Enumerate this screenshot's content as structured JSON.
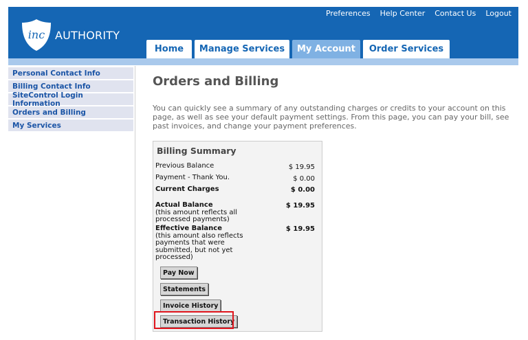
{
  "header": {
    "logo_mark": "inc",
    "logo_text": "AUTHORITY",
    "links": [
      "Preferences",
      "Help Center",
      "Contact Us",
      "Logout"
    ]
  },
  "tabs": [
    {
      "label": "Home",
      "active": false
    },
    {
      "label": "Manage Services",
      "active": false
    },
    {
      "label": "My Account",
      "active": true
    },
    {
      "label": "Order Services",
      "active": false
    }
  ],
  "sidebar": {
    "items": [
      {
        "label": "Personal Contact Info"
      },
      {
        "label": "Billing Contact Info"
      },
      {
        "label": "SiteControl Login Information"
      },
      {
        "label": "Orders and Billing"
      },
      {
        "label": "My Services"
      }
    ]
  },
  "main": {
    "title": "Orders and Billing",
    "intro": "You can quickly see a summary of any outstanding charges or credits to your account on this page, as well as see your default payment settings. From this page, you can pay your bill, see past invoices, and change your payment preferences."
  },
  "billing": {
    "title": "Billing Summary",
    "previous_balance_label": "Previous Balance",
    "previous_balance_value": "$ 19.95",
    "payment_label": "Payment - Thank You.",
    "payment_value": "$ 0.00",
    "current_charges_label": "Current Charges",
    "current_charges_value": "$ 0.00",
    "actual_balance_label": "Actual Balance",
    "actual_balance_note": "(this amount reflects all processed payments)",
    "actual_balance_value": "$ 19.95",
    "effective_balance_label": "Effective Balance",
    "effective_balance_note": "(this amount also reflects payments that were submitted, but not yet processed)",
    "effective_balance_value": "$ 19.95",
    "buttons": {
      "pay_now": "Pay Now",
      "statements": "Statements",
      "invoice_history": "Invoice History",
      "transaction_history": "Transaction History"
    }
  },
  "colors": {
    "header_blue": "#1566b4",
    "active_tab": "#7fb1e3",
    "highlight_red": "#e0141c"
  }
}
